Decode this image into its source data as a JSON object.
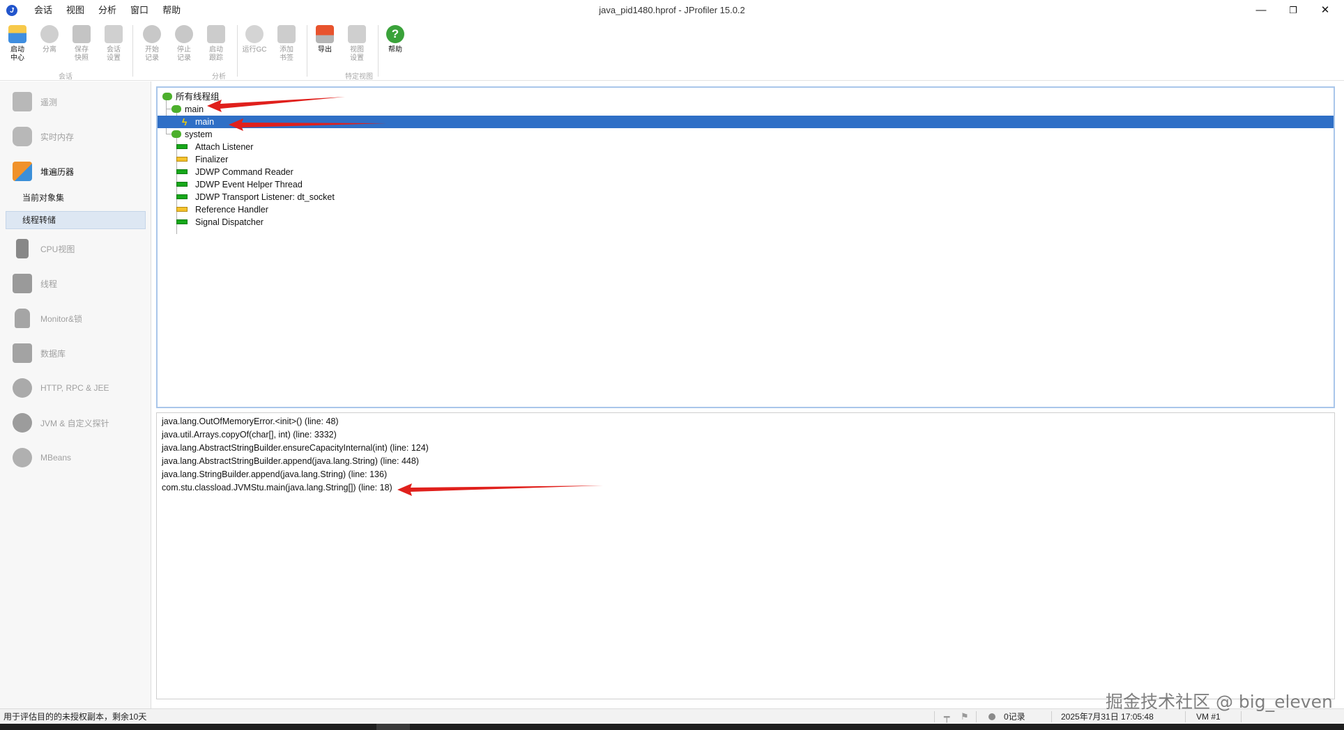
{
  "window": {
    "title": "java_pid1480.hprof - JProfiler 15.0.2",
    "minimize": "—",
    "maximize": "❐",
    "close": "✕"
  },
  "menu": [
    "会话",
    "视图",
    "分析",
    "窗口",
    "帮助"
  ],
  "toolbar": {
    "tools": [
      {
        "label": "启动\n中心",
        "icon": "folder-icon"
      },
      {
        "label": "分离",
        "icon": "detach-icon"
      },
      {
        "label": "保存\n快照",
        "icon": "save-icon"
      },
      {
        "label": "会话\n设置",
        "icon": "session-settings-icon"
      },
      {
        "label": "开始\n记录",
        "icon": "start-record-icon"
      },
      {
        "label": "停止\n记录",
        "icon": "stop-record-icon"
      },
      {
        "label": "启动\n跟踪",
        "icon": "start-tracking-icon"
      },
      {
        "label": "运行GC",
        "icon": "gc-icon"
      },
      {
        "label": "添加\n书签",
        "icon": "bookmark-icon"
      },
      {
        "label": "导出",
        "icon": "export-icon"
      },
      {
        "label": "视图\n设置",
        "icon": "view-settings-icon"
      },
      {
        "label": "帮助",
        "icon": "help-icon"
      }
    ],
    "groups": [
      "会话",
      "分析",
      "特定视图"
    ]
  },
  "sidebar": {
    "items": [
      {
        "label": "遥测",
        "icon": "telemetry-icon"
      },
      {
        "label": "实时内存",
        "icon": "live-memory-icon"
      },
      {
        "label": "堆遍历器",
        "icon": "heap-walker-icon"
      },
      {
        "label": "CPU视图",
        "icon": "cpu-icon"
      },
      {
        "label": "线程",
        "icon": "threads-icon"
      },
      {
        "label": "Monitor&锁",
        "icon": "lock-icon"
      },
      {
        "label": "数据库",
        "icon": "database-icon"
      },
      {
        "label": "HTTP, RPC & JEE",
        "icon": "globe-icon"
      },
      {
        "label": "JVM & 自定义探针",
        "icon": "probe-icon"
      },
      {
        "label": "MBeans",
        "icon": "mbeans-icon"
      }
    ],
    "sub_items": [
      "当前对象集",
      "线程转储"
    ]
  },
  "tree": {
    "root": "所有线程组",
    "group_main": "main",
    "thread_main": "main",
    "group_system": "system",
    "threads": [
      {
        "label": "Attach Listener",
        "state": "runnable"
      },
      {
        "label": "Finalizer",
        "state": "waiting"
      },
      {
        "label": "JDWP Command Reader",
        "state": "runnable"
      },
      {
        "label": "JDWP Event Helper Thread",
        "state": "runnable"
      },
      {
        "label": "JDWP Transport Listener: dt_socket",
        "state": "runnable"
      },
      {
        "label": "Reference Handler",
        "state": "waiting"
      },
      {
        "label": "Signal Dispatcher",
        "state": "runnable"
      }
    ]
  },
  "stack": [
    "java.lang.OutOfMemoryError.<init>() (line: 48)",
    "java.util.Arrays.copyOf(char[], int) (line: 3332)",
    "java.lang.AbstractStringBuilder.ensureCapacityInternal(int) (line: 124)",
    "java.lang.AbstractStringBuilder.append(java.lang.String) (line: 448)",
    "java.lang.StringBuilder.append(java.lang.String) (line: 136)",
    "com.stu.classload.JVMStu.main(java.lang.String[]) (line: 18)"
  ],
  "status": {
    "license": "用于评估目的的未授权副本，剩余10天",
    "records": "0记录",
    "datetime": "2025年7月31日 17:05:48",
    "vm": "VM #1"
  },
  "watermark": "掘金技术社区 @ big_eleven",
  "colors": {
    "selection": "#2f6fc6",
    "runnable": "#17a81a",
    "waiting": "#f5c22b",
    "annotation_arrow": "#e0201c"
  }
}
